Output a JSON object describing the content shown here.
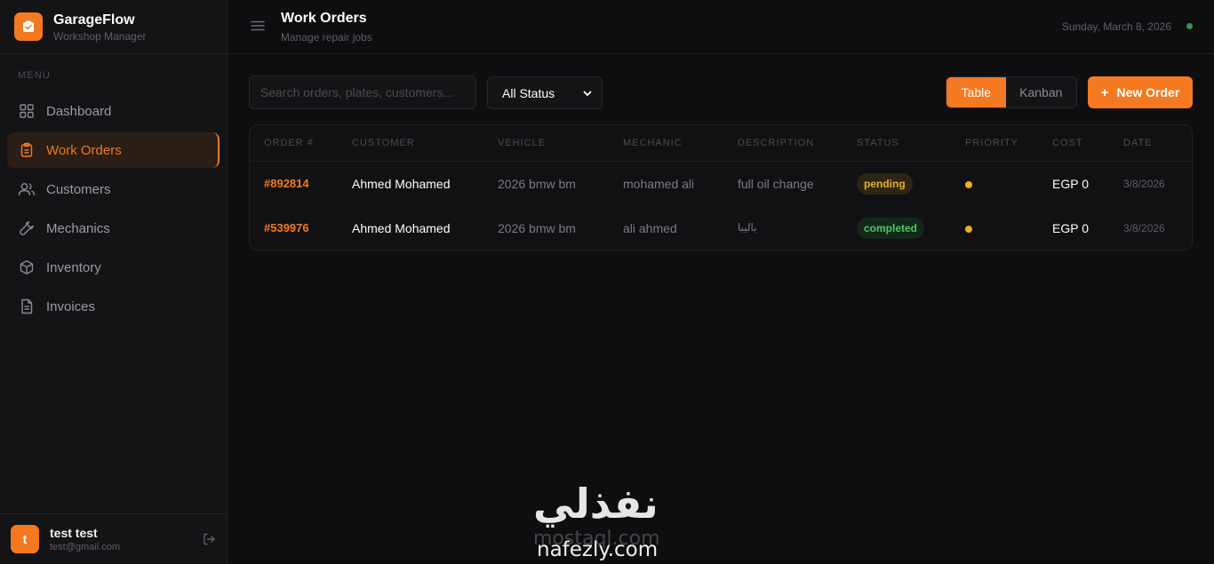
{
  "app": {
    "name": "GarageFlow",
    "subtitle": "Workshop Manager"
  },
  "sidebar": {
    "menu_label": "MENU",
    "items": [
      {
        "label": "Dashboard",
        "icon": "grid-icon",
        "active": false
      },
      {
        "label": "Work Orders",
        "icon": "clipboard-icon",
        "active": true
      },
      {
        "label": "Customers",
        "icon": "users-icon",
        "active": false
      },
      {
        "label": "Mechanics",
        "icon": "wrench-icon",
        "active": false
      },
      {
        "label": "Inventory",
        "icon": "box-icon",
        "active": false
      },
      {
        "label": "Invoices",
        "icon": "file-icon",
        "active": false
      }
    ],
    "user": {
      "initial": "t",
      "name": "test test",
      "email": "test@gmail.com"
    }
  },
  "header": {
    "title": "Work Orders",
    "subtitle": "Manage repair jobs",
    "date": "Sunday, March 8, 2026"
  },
  "toolbar": {
    "search_placeholder": "Search orders, plates, customers...",
    "status_filter": "All Status",
    "view_table": "Table",
    "view_kanban": "Kanban",
    "new_order_label": "New Order"
  },
  "table": {
    "columns": [
      "ORDER #",
      "CUSTOMER",
      "VEHICLE",
      "MECHANIC",
      "DESCRIPTION",
      "STATUS",
      "PRIORITY",
      "COST",
      "DATE"
    ],
    "rows": [
      {
        "order": "#892814",
        "customer": "Ahmed Mohamed",
        "vehicle": "2026 bmw bm",
        "mechanic": "mohamed ali",
        "description": "full oil change",
        "status": "pending",
        "cost": "EGP 0",
        "date": "3/8/2026"
      },
      {
        "order": "#539976",
        "customer": "Ahmed Mohamed",
        "vehicle": "2026 bmw bm",
        "mechanic": "ali ahmed",
        "description": "باليبا",
        "status": "completed",
        "cost": "EGP 0",
        "date": "3/8/2026"
      }
    ]
  },
  "watermark": {
    "arabic": "نفذلي",
    "site1": "mostaql.com",
    "site2": "nafezly.com"
  },
  "colors": {
    "accent": "#f47920",
    "background": "#0e0e10",
    "sidebar": "#141416",
    "pending": "#e8b026",
    "completed": "#48c864",
    "online": "#3e8e4f"
  }
}
